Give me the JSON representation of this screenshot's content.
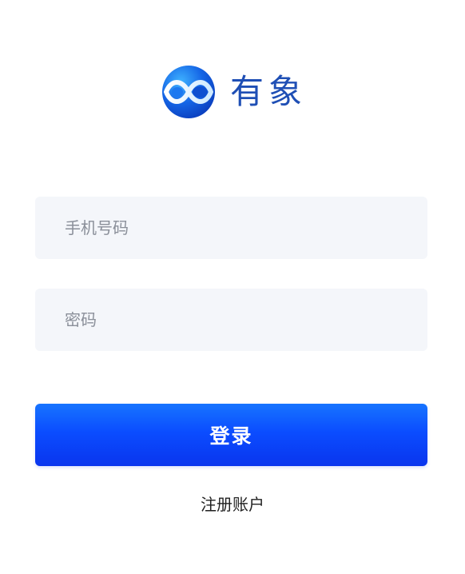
{
  "brand": {
    "name": "有象",
    "logo_icon": "infinity-orb-logo",
    "brand_color": "#1f4fb5"
  },
  "form": {
    "phone": {
      "placeholder": "手机号码",
      "value": ""
    },
    "password": {
      "placeholder": "密码",
      "value": ""
    },
    "login_label": "登录",
    "register_label": "注册账户"
  },
  "colors": {
    "button_gradient_top": "#1774ff",
    "button_gradient_bottom": "#0a35ee",
    "field_background": "#f4f6fa",
    "placeholder_text": "#8a8f99"
  }
}
